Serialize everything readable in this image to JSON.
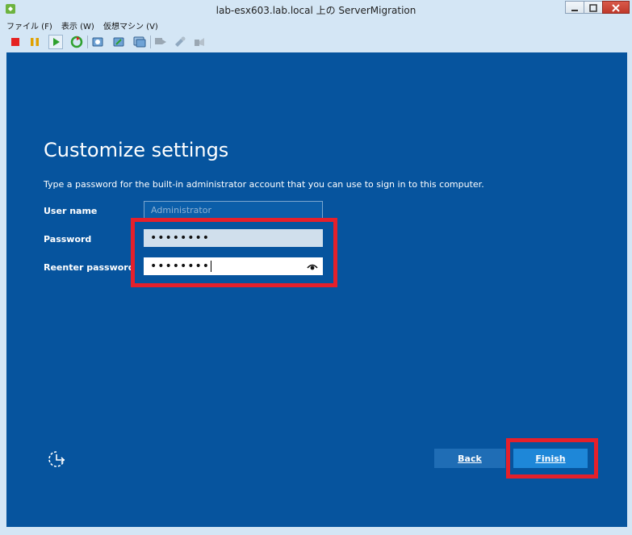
{
  "window": {
    "title": "lab-esx603.lab.local 上の ServerMigration"
  },
  "menu": {
    "items": [
      {
        "label": "ファイル (F)"
      },
      {
        "label": "表示 (W)"
      },
      {
        "label": "仮想マシン (V)"
      }
    ]
  },
  "toolbar": {
    "icons": [
      "stop-icon",
      "pause-icon",
      "play-icon",
      "reset-icon",
      "snapshot-icon",
      "revert-snapshot-icon",
      "snapshot-manager-icon",
      "console-icon",
      "settings-icon",
      "send-keys-icon"
    ]
  },
  "setup": {
    "heading": "Customize settings",
    "description": "Type a password for the built-in administrator account that you can use to sign in to this computer.",
    "user_name_label": "User name",
    "user_name_placeholder": "Administrator",
    "password_label": "Password",
    "password_value": "••••••••",
    "reenter_label": "Reenter password",
    "reenter_value": "••••••••",
    "back_label": "Back",
    "finish_label": "Finish"
  },
  "colors": {
    "screen_bg": "#06549e",
    "highlight": "#e5202b",
    "finish_bg": "#1e87d8"
  }
}
